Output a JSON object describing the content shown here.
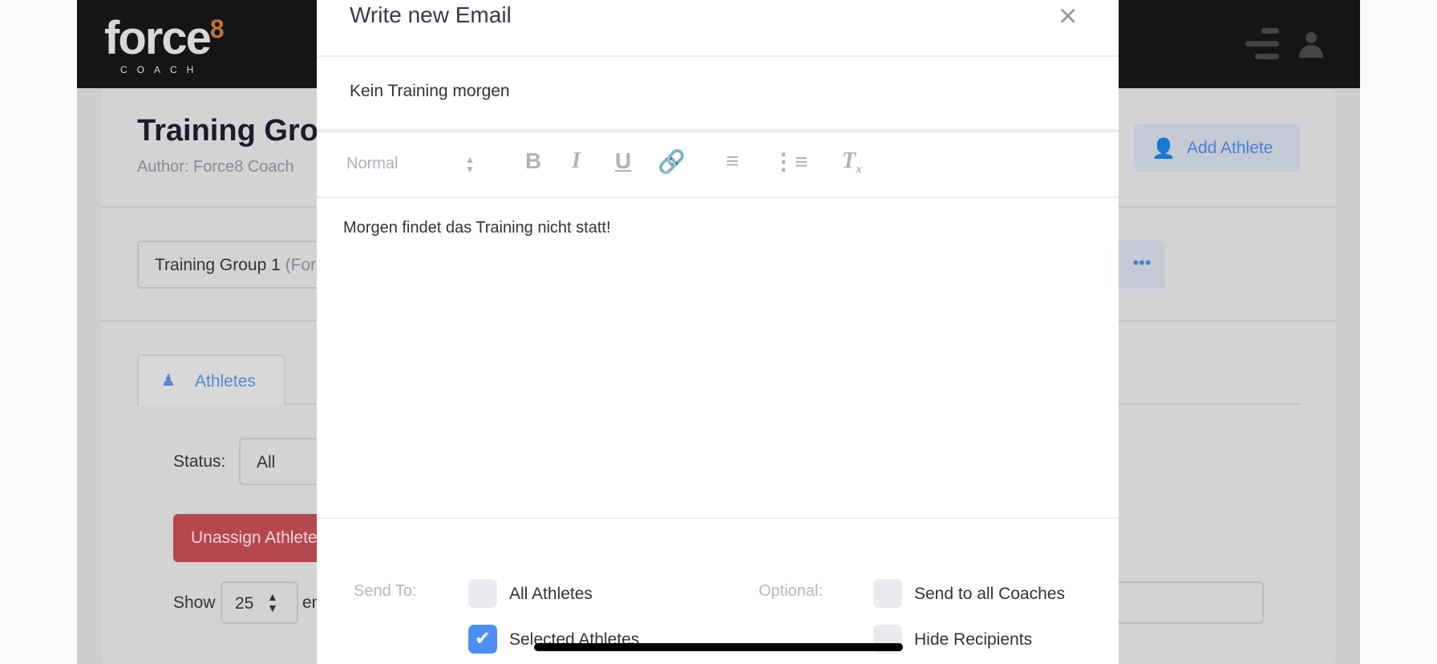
{
  "header": {
    "logo": "force",
    "logo_sup": "8",
    "logo_sub": "COACH"
  },
  "background": {
    "page_title": "Training Gro",
    "author": "Author: Force8 Coach",
    "add_athlete": "Add Athlete",
    "group_select": "Training Group 1",
    "group_select_suffix": "(For",
    "tab_athletes": "Athletes",
    "status_label": "Status:",
    "status_value": "All",
    "unassign_button": "Unassign Athlete",
    "show_label": "Show",
    "show_value": "25",
    "entries_label": "en"
  },
  "modal": {
    "title": "Write new Email",
    "subject": "Kein Training morgen",
    "toolbar": {
      "format": "Normal",
      "bold": "B",
      "italic": "I",
      "underline": "U"
    },
    "body": "Morgen findet das Training nicht statt!",
    "send_to_label": "Send To:",
    "optional_label": "Optional:",
    "options": {
      "all_athletes": "All Athletes",
      "selected_athletes": "Selected Athletes",
      "all_coaches": "Send to all Coaches",
      "hide_recipients": "Hide Recipients"
    },
    "checked": {
      "all_athletes": false,
      "selected_athletes": true,
      "all_coaches": false,
      "hide_recipients": false
    }
  },
  "colors": {
    "accent": "#4d8ff0",
    "danger": "#b5474f",
    "header": "#151515"
  }
}
